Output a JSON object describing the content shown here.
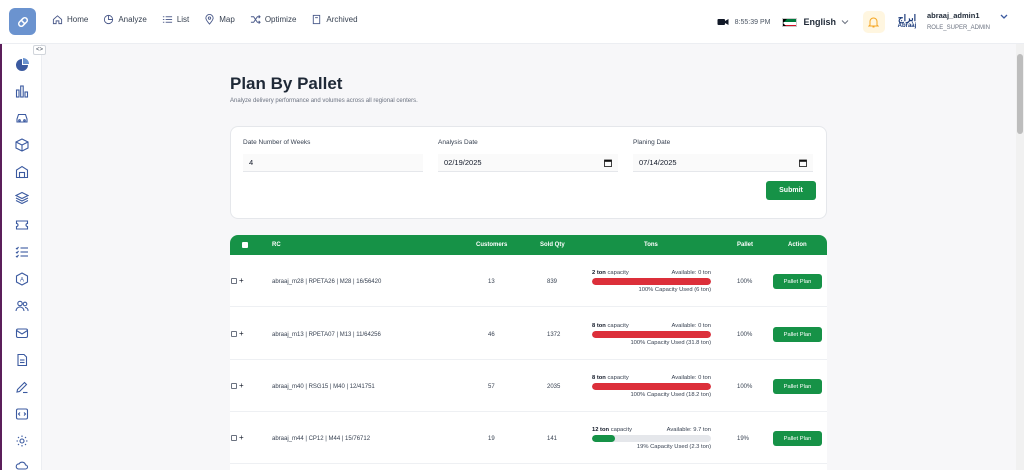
{
  "colors": {
    "brand_green": "#169247",
    "danger_red": "#dc2f3a",
    "accent_blue": "#6b93cf",
    "sidebar_strip": "#5b1e5a"
  },
  "nav": [
    {
      "label": "Home",
      "icon": "home-icon"
    },
    {
      "label": "Analyze",
      "icon": "pie-chart-icon"
    },
    {
      "label": "List",
      "icon": "list-icon"
    },
    {
      "label": "Map",
      "icon": "map-pin-icon"
    },
    {
      "label": "Optimize",
      "icon": "shuffle-icon"
    },
    {
      "label": "Archived",
      "icon": "archive-icon"
    }
  ],
  "header": {
    "time": "8:55:39 PM",
    "language": "English",
    "user_name": "abraaj_admin1",
    "user_role": "ROLE_SUPER_ADMIN",
    "brand_ar": "ابراج",
    "brand_en": "Abraaj"
  },
  "sidebar_icons": [
    "pie-chart-icon",
    "bar-chart-icon",
    "car-icon",
    "box-icon",
    "warehouse-icon",
    "layers-icon",
    "ticket-icon",
    "list-check-icon",
    "translate-icon",
    "users-icon",
    "mail-icon",
    "file-icon",
    "edit-icon",
    "code-icon",
    "settings-icon",
    "cloud-icon"
  ],
  "page": {
    "title": "Plan By Pallet",
    "subtitle": "Analyze delivery performance and volumes across all regional centers."
  },
  "form": {
    "weeks_label": "Date Number of Weeks",
    "weeks_value": "4",
    "analysis_label": "Analysis Date",
    "analysis_value": "02/19/2025",
    "planning_label": "Planing Date",
    "planning_value": "07/14/2025",
    "submit": "Submit"
  },
  "table": {
    "headers": {
      "rc": "RC",
      "customers": "Customers",
      "sold_qty": "Sold Qty",
      "tons": "Tons",
      "pallet": "Pallet",
      "action": "Action"
    },
    "rows": [
      {
        "rc": "abraaj_m28 | RPETA26 | M28 | 16/56420",
        "customers": "13",
        "sold_qty": "839",
        "tons_cap": "2 ton",
        "cap_word": "capacity",
        "available": "Available: 0 ton",
        "used": "100% Capacity Used (6 ton)",
        "fill": 1.0,
        "fill_color": "#dc2f3a",
        "pallet": "100%",
        "action": "Pallet Plan"
      },
      {
        "rc": "abraaj_m13 | RPETA07 | M13 | 11/64256",
        "customers": "46",
        "sold_qty": "1372",
        "tons_cap": "8 ton",
        "cap_word": "capacity",
        "available": "Available: 0 ton",
        "used": "100% Capacity Used (31.8 ton)",
        "fill": 1.0,
        "fill_color": "#dc2f3a",
        "pallet": "100%",
        "action": "Pallet Plan"
      },
      {
        "rc": "abraaj_m40 | RSG15 | M40 | 12/41751",
        "customers": "57",
        "sold_qty": "2035",
        "tons_cap": "8 ton",
        "cap_word": "capacity",
        "available": "Available: 0 ton",
        "used": "100% Capacity Used (18.2 ton)",
        "fill": 1.0,
        "fill_color": "#dc2f3a",
        "pallet": "100%",
        "action": "Pallet Plan"
      },
      {
        "rc": "abraaj_m44 | CP12 | M44 | 15/76712",
        "customers": "19",
        "sold_qty": "141",
        "tons_cap": "12 ton",
        "cap_word": "capacity",
        "available": "Available: 9.7 ton",
        "used": "19% Capacity Used (2.3 ton)",
        "fill": 0.19,
        "fill_color": "#169247",
        "pallet": "19%",
        "action": "Pallet Plan"
      }
    ]
  }
}
